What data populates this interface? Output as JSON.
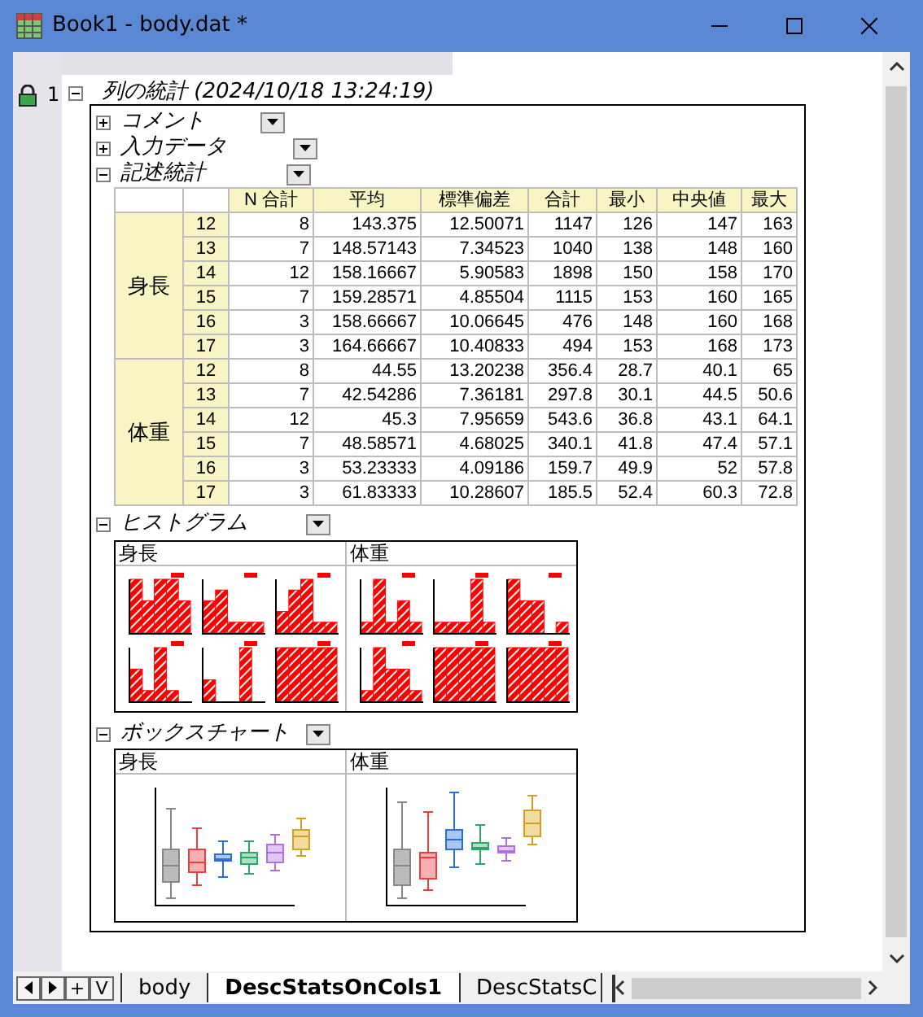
{
  "window": {
    "title": "Book1 - body.dat *"
  },
  "row_number": "1",
  "report": {
    "title": "列の統計 (2024/10/18 13:24:19)",
    "expanded": true,
    "sections": [
      {
        "kind": "folder",
        "title": "コメント",
        "expanded": false
      },
      {
        "kind": "folder",
        "title": "入力データ",
        "expanded": false
      },
      {
        "kind": "table",
        "title": "記述統計",
        "expanded": true,
        "table": {
          "columns": [
            "N 合計",
            "平均",
            "標準偏差",
            "合計",
            "最小",
            "中央値",
            "最大"
          ],
          "groups": [
            {
              "label": "身長",
              "rows": [
                [
                  "12",
                  "8",
                  "143.375",
                  "12.50071",
                  "1147",
                  "126",
                  "147",
                  "163"
                ],
                [
                  "13",
                  "7",
                  "148.57143",
                  "7.34523",
                  "1040",
                  "138",
                  "148",
                  "160"
                ],
                [
                  "14",
                  "12",
                  "158.16667",
                  "5.90583",
                  "1898",
                  "150",
                  "158",
                  "170"
                ],
                [
                  "15",
                  "7",
                  "159.28571",
                  "4.85504",
                  "1115",
                  "153",
                  "160",
                  "165"
                ],
                [
                  "16",
                  "3",
                  "158.66667",
                  "10.06645",
                  "476",
                  "148",
                  "160",
                  "168"
                ],
                [
                  "17",
                  "3",
                  "164.66667",
                  "10.40833",
                  "494",
                  "153",
                  "168",
                  "173"
                ]
              ]
            },
            {
              "label": "体重",
              "rows": [
                [
                  "12",
                  "8",
                  "44.55",
                  "13.20238",
                  "356.4",
                  "28.7",
                  "40.1",
                  "65"
                ],
                [
                  "13",
                  "7",
                  "42.54286",
                  "7.36181",
                  "297.8",
                  "30.1",
                  "44.5",
                  "50.6"
                ],
                [
                  "14",
                  "12",
                  "45.3",
                  "7.95659",
                  "543.6",
                  "36.8",
                  "43.1",
                  "64.1"
                ],
                [
                  "15",
                  "7",
                  "48.58571",
                  "4.68025",
                  "340.1",
                  "41.8",
                  "47.4",
                  "57.1"
                ],
                [
                  "16",
                  "3",
                  "53.23333",
                  "4.09186",
                  "159.7",
                  "49.9",
                  "52",
                  "57.8"
                ],
                [
                  "17",
                  "3",
                  "61.83333",
                  "10.28607",
                  "185.5",
                  "52.4",
                  "60.3",
                  "72.8"
                ]
              ]
            }
          ]
        }
      },
      {
        "kind": "histograms",
        "title": "ヒストグラム",
        "expanded": true,
        "panels": [
          {
            "label": "身長"
          },
          {
            "label": "体重"
          }
        ]
      },
      {
        "kind": "boxcharts",
        "title": "ボックスチャート",
        "expanded": true,
        "panels": [
          {
            "label": "身長"
          },
          {
            "label": "体重"
          }
        ]
      }
    ]
  },
  "sheet_nav": {
    "add": "+",
    "menu": "V"
  },
  "sheet_tabs": [
    {
      "label": "body",
      "selected": false
    },
    {
      "label": "DescStatsOnCols1",
      "selected": true
    },
    {
      "label": "DescStatsC",
      "selected": false
    }
  ]
}
